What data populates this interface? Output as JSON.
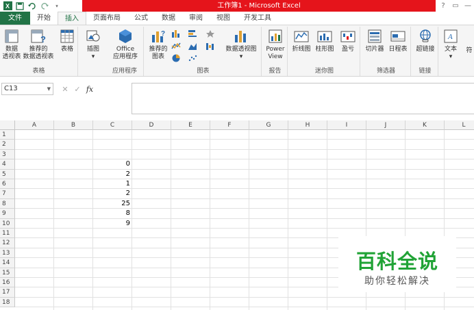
{
  "window": {
    "title": "工作簿1 -  Microsoft Excel",
    "controls": [
      "?",
      "▭",
      "—"
    ]
  },
  "tabs": [
    {
      "label": "文件"
    },
    {
      "label": "开始"
    },
    {
      "label": "插入"
    },
    {
      "label": "页面布局"
    },
    {
      "label": "公式"
    },
    {
      "label": "数据"
    },
    {
      "label": "审阅"
    },
    {
      "label": "视图"
    },
    {
      "label": "开发工具"
    }
  ],
  "ribbon": {
    "groups": {
      "tables": "表格",
      "apps": "应用程序",
      "charts": "图表",
      "reports": "报告",
      "sparklines": "迷你图",
      "filters": "筛选器",
      "links": "链接"
    },
    "buttons": {
      "pivot_table": [
        "数据",
        "透视表"
      ],
      "recommended_pivot": [
        "推荐的",
        "数据透视表"
      ],
      "table": "表格",
      "illustrations": "插图",
      "office_apps": [
        "Office",
        "应用程序"
      ],
      "recommended_charts": [
        "推荐的",
        "图表"
      ],
      "pivot_chart": "数据透视图",
      "power_view": [
        "Power",
        "View"
      ],
      "line": "折线图",
      "column": "柱形图",
      "win_loss": "盈亏",
      "slicer": "切片器",
      "timeline": "日程表",
      "hyperlink": "超链接",
      "text": "文本",
      "symbol": "符"
    }
  },
  "formula_bar": {
    "name_box": "C13",
    "cancel": "✕",
    "enter": "✓",
    "fx": "fx",
    "value": ""
  },
  "sheet": {
    "columns": [
      "A",
      "B",
      "C",
      "D",
      "E",
      "F",
      "G",
      "H",
      "I",
      "J",
      "K",
      "L"
    ],
    "rows": [
      "1",
      "2",
      "3",
      "4",
      "5",
      "6",
      "7",
      "8",
      "9",
      "10",
      "11",
      "12",
      "13",
      "14",
      "15",
      "16",
      "17",
      "18"
    ],
    "cells": [
      {
        "ref": "C4",
        "value": "0"
      },
      {
        "ref": "C5",
        "value": "2"
      },
      {
        "ref": "C6",
        "value": "1"
      },
      {
        "ref": "C7",
        "value": "2"
      },
      {
        "ref": "C8",
        "value": "25"
      },
      {
        "ref": "C9",
        "value": "8"
      },
      {
        "ref": "C10",
        "value": "9"
      }
    ]
  },
  "watermark": {
    "title": "百科全说",
    "subtitle": "助你轻松解决"
  }
}
